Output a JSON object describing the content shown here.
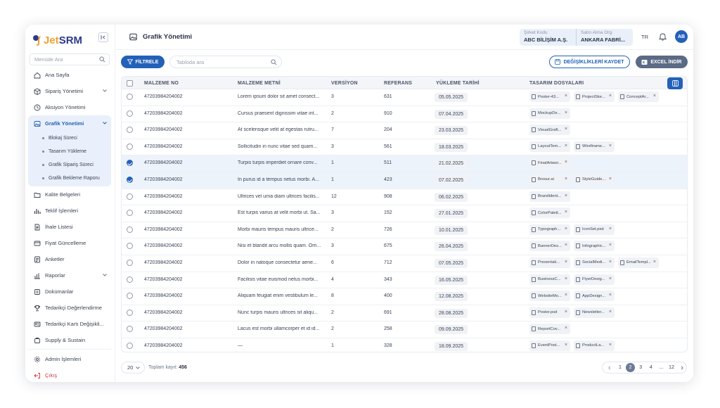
{
  "brand": {
    "name_prefix": "Jet",
    "name_suffix": "SRM"
  },
  "sidebar": {
    "search_placeholder": "Menüde Ara",
    "items": [
      {
        "label": "Ana Sayfa",
        "icon": "home-icon"
      },
      {
        "label": "Sipariş Yönetimi",
        "icon": "box-icon",
        "expandable": true
      },
      {
        "label": "Aksiyon Yönetimi",
        "icon": "clock-icon"
      },
      {
        "label": "Grafik Yönetimi",
        "icon": "image-icon",
        "expandable": true,
        "active": true,
        "children": [
          "Blokaj Süreci",
          "Tasarım Yükleme",
          "Grafik Sipariş Süreci",
          "Grafik Bekleme Raporu"
        ]
      },
      {
        "label": "Kalite Belgeleri",
        "icon": "folder-icon"
      },
      {
        "label": "Teklif İşlemleri",
        "icon": "chart-icon"
      },
      {
        "label": "İhale Listesi",
        "icon": "document-icon"
      },
      {
        "label": "Fiyat Güncelleme",
        "icon": "card-icon"
      },
      {
        "label": "Anketler",
        "icon": "survey-icon"
      },
      {
        "label": "Raporlar",
        "icon": "report-icon",
        "expandable": true
      },
      {
        "label": "Dokümanlar",
        "icon": "docs-icon"
      },
      {
        "label": "Tedarikçi Değerlendirme",
        "icon": "trophy-icon"
      },
      {
        "label": "Tedarikçi Kartı Değişikli...",
        "icon": "id-card-icon"
      },
      {
        "label": "Supply & Sustain",
        "icon": "leaf-icon"
      }
    ],
    "admin_label": "Admin İşlemleri",
    "logout_label": "Çıkış"
  },
  "header": {
    "title": "Grafik Yönetimi",
    "company_code_label": "Şirket Kodu",
    "company_code_value": "ABC BİLİŞİM A.Ş.",
    "purchasing_org_label": "Satın Alma Org.",
    "purchasing_org_value": "ANKARA FABRİ...",
    "language": "TR",
    "avatar_initials": "AB"
  },
  "toolbar": {
    "filter_label": "FİLTRELE",
    "search_placeholder": "Tabloda ara",
    "save_label": "DEĞİŞİKLİKLERİ KAYDET",
    "excel_label": "EXCEL İNDİR"
  },
  "table": {
    "headers": [
      "MALZEME NO",
      "MALZEME METNİ",
      "VERSİYON",
      "REFERANS",
      "YÜKLEME TARİHİ",
      "TASARIM DOSYALARI"
    ],
    "rows": [
      {
        "no": "47203984204002",
        "text": "Lorem ipsum dolor sit amet consect...",
        "version": "3",
        "ref": "631",
        "date": "05.05.2025",
        "files": [
          "Poster-43...",
          "ProjectSke...",
          "ConceptAr..."
        ],
        "selected": false
      },
      {
        "no": "47203984204002",
        "text": "Cursus praesent dignissim vitae int...",
        "version": "2",
        "ref": "910",
        "date": "07.04.2025",
        "files": [
          "MockupDe..."
        ],
        "selected": false
      },
      {
        "no": "47203984204002",
        "text": "At scelerisque velit at egestas rutru...",
        "version": "7",
        "ref": "204",
        "date": "23.03.2025",
        "files": [
          "VisualGraft..."
        ],
        "selected": false
      },
      {
        "no": "47203984204002",
        "text": "Sollicitudin in nunc vitae sed quam...",
        "version": "3",
        "ref": "561",
        "date": "18.03.2025",
        "files": [
          "LayoutTem...",
          "Wirefirame..."
        ],
        "selected": false
      },
      {
        "no": "47203984204002",
        "text": "Turpis turpis imperdiet ornare conv...",
        "version": "1",
        "ref": "511",
        "date": "21.02.2025",
        "files": [
          "FinalArtwor..."
        ],
        "selected": true
      },
      {
        "no": "47203984204002",
        "text": "In purus id a tempus netus morbi. A...",
        "version": "1",
        "ref": "423",
        "date": "07.02.2025",
        "files": [
          "Brosur.ai",
          "StyleGuide..."
        ],
        "selected": true
      },
      {
        "no": "47203984204002",
        "text": "Ultrices vel urna diam ultrices facilis...",
        "version": "12",
        "ref": "908",
        "date": "06.02.2025",
        "files": [
          "BrandIdent..."
        ],
        "selected": false
      },
      {
        "no": "47203984204002",
        "text": "Est turpis varius at velit morbi ut. Sa...",
        "version": "3",
        "ref": "152",
        "date": "27.01.2025",
        "files": [
          "ColorPalett..."
        ],
        "selected": false
      },
      {
        "no": "47203984204002",
        "text": "Morbi mauris tempus mauris ultrice...",
        "version": "2",
        "ref": "726",
        "date": "10.01.2025",
        "files": [
          "Typograph...",
          "IconSet.psd"
        ],
        "selected": false
      },
      {
        "no": "47203984204002",
        "text": "Nisi et blandit arcu mollis quam. Orn...",
        "version": "3",
        "ref": "675",
        "date": "26.04.2025",
        "files": [
          "BannerDes...",
          "Infographic..."
        ],
        "selected": false
      },
      {
        "no": "47203984204002",
        "text": "Dolor in natoque consectetur aene...",
        "version": "6",
        "ref": "712",
        "date": "07.05.2025",
        "files": [
          "Presentati...",
          "SocialMedi...",
          "EmailTempl..."
        ],
        "selected": false
      },
      {
        "no": "47203984204002",
        "text": "Facilisis vitae euismod netus morbi...",
        "version": "4",
        "ref": "343",
        "date": "16.05.2025",
        "files": [
          "BusinessC...",
          "FlyerDesig..."
        ],
        "selected": false
      },
      {
        "no": "47203984204002",
        "text": "Aliquam feugiat enim vestibulum le...",
        "version": "8",
        "ref": "400",
        "date": "12.08.2025",
        "files": [
          "WebsiteMo...",
          "AppDesign..."
        ],
        "selected": false
      },
      {
        "no": "47203984204002",
        "text": "Nunc turpis mauris ultrices sit aliqu...",
        "version": "2",
        "ref": "691",
        "date": "28.08.2025",
        "files": [
          "Poster.psd",
          "Newsletter..."
        ],
        "selected": false
      },
      {
        "no": "47203984204002",
        "text": "Lacus est morbi ullamcorper et id id...",
        "version": "2",
        "ref": "258",
        "date": "09.09.2025",
        "files": [
          "ReportCov..."
        ],
        "selected": false
      },
      {
        "no": "47203984204002",
        "text": "—",
        "version": "1",
        "ref": "328",
        "date": "18.09.2025",
        "files": [
          "EventPost...",
          "ProductLa..."
        ],
        "selected": false
      }
    ]
  },
  "footer": {
    "page_size": "20",
    "total_label": "Toplam kayıt:",
    "total_value": "456",
    "pages": [
      "1",
      "2",
      "3",
      "4",
      "...",
      "12"
    ],
    "current_page": "2"
  },
  "colors": {
    "primary": "#2361b8",
    "accent": "#f2a12e",
    "excel": "#5b6a85",
    "logout": "#d3343f"
  }
}
